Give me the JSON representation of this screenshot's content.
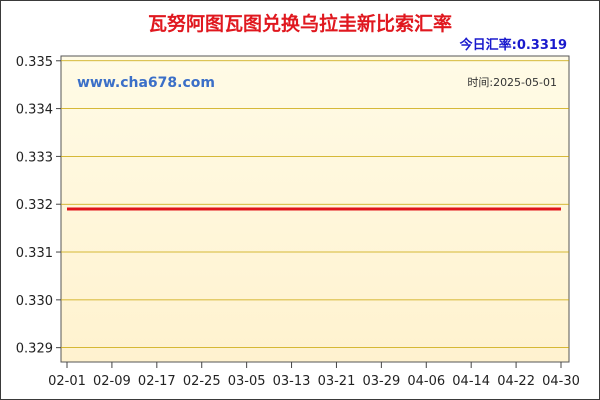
{
  "header": {
    "title": "瓦努阿图瓦图兑换乌拉圭新比索汇率",
    "rate_label": "今日汇率:",
    "rate_value": "0.3319"
  },
  "watermark": "www.cha678.com",
  "date_text": "时间:2025-05-01",
  "colors": {
    "title": "#e0181f",
    "rate": "#1a1acd",
    "watermark": "#3b6fc8",
    "line": "#e0141b",
    "plot_bg_top": "#fffbe6",
    "plot_bg_bottom": "#fff2cf",
    "gridline": "#c8a400"
  },
  "chart_data": {
    "type": "line",
    "title": "瓦努阿图瓦图兑换乌拉圭新比索汇率",
    "xlabel": "",
    "ylabel": "",
    "x_ticks": [
      "02-01",
      "02-09",
      "02-17",
      "02-25",
      "03-05",
      "03-13",
      "03-21",
      "03-29",
      "04-06",
      "04-14",
      "04-22",
      "04-30"
    ],
    "y_ticks": [
      "0.335",
      "0.334",
      "0.333",
      "0.332",
      "0.331",
      "0.330",
      "0.329"
    ],
    "ylim": [
      0.3287,
      0.3351
    ],
    "grid": true,
    "series": [
      {
        "x": [
          "02-01",
          "04-30"
        ],
        "values": [
          0.3319,
          0.3319
        ]
      }
    ]
  }
}
